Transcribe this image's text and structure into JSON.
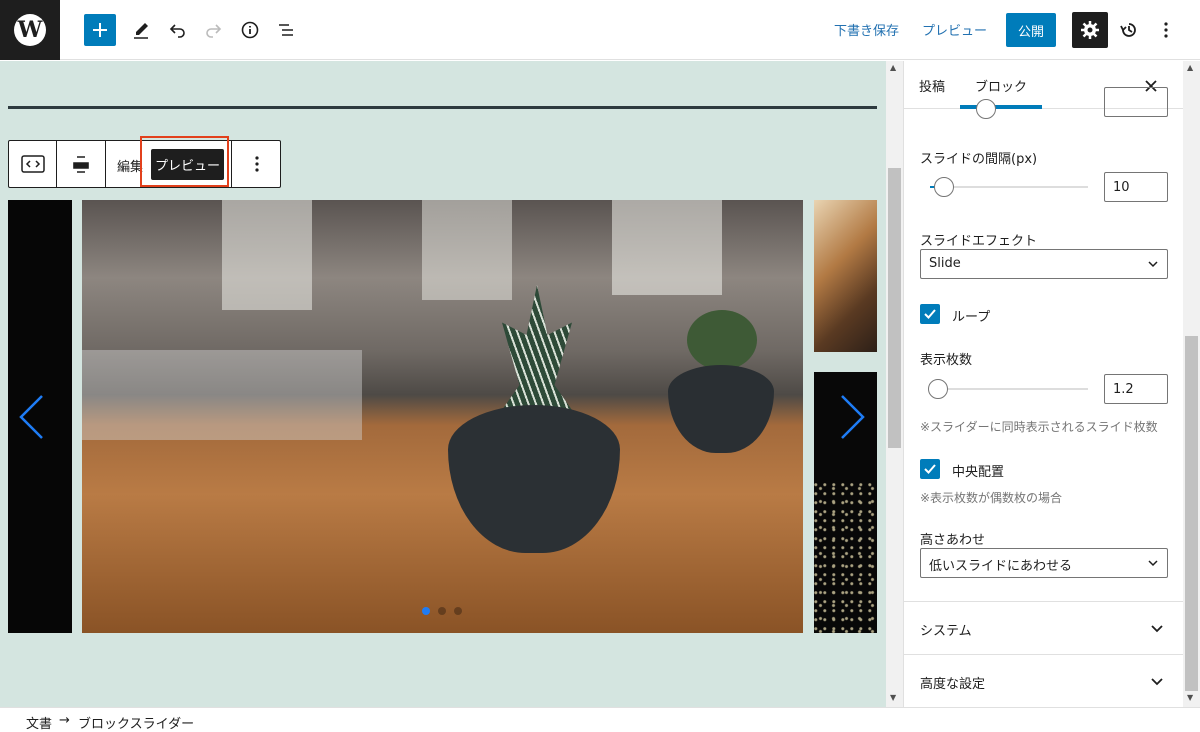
{
  "toolbar": {
    "draft_save": "下書き保存",
    "preview": "プレビュー",
    "publish": "公開"
  },
  "block_toolbar": {
    "edit_label": "編集",
    "preview_label": "プレビュー"
  },
  "slider": {
    "dots": 3,
    "active_dot": 0
  },
  "sidebar": {
    "tabs": [
      {
        "label": "投稿",
        "active": false
      },
      {
        "label": "ブロック",
        "active": true
      }
    ],
    "slide_gap": {
      "label": "スライドの間隔(px)",
      "value": "10"
    },
    "slide_effect": {
      "label": "スライドエフェクト",
      "value": "Slide"
    },
    "loop": {
      "label": "ループ",
      "checked": true
    },
    "display_count": {
      "label": "表示枚数",
      "value": "1.2",
      "help": "※スライダーに同時表示されるスライド枚数"
    },
    "center": {
      "label": "中央配置",
      "checked": true,
      "help": "※表示枚数が偶数枚の場合"
    },
    "height_match": {
      "label": "高さあわせ",
      "value": "低いスライドにあわせる"
    },
    "panels": [
      {
        "title": "システム"
      },
      {
        "title": "高度な設定"
      }
    ]
  },
  "breadcrumb": {
    "root": "文書",
    "separator": "→",
    "current": "ブロックスライダー"
  },
  "colors": {
    "accent": "#007cba",
    "canvas_bg": "#d4e5e0",
    "highlight_border": "#e2401c",
    "slider_arrow": "#1e7cf5"
  }
}
